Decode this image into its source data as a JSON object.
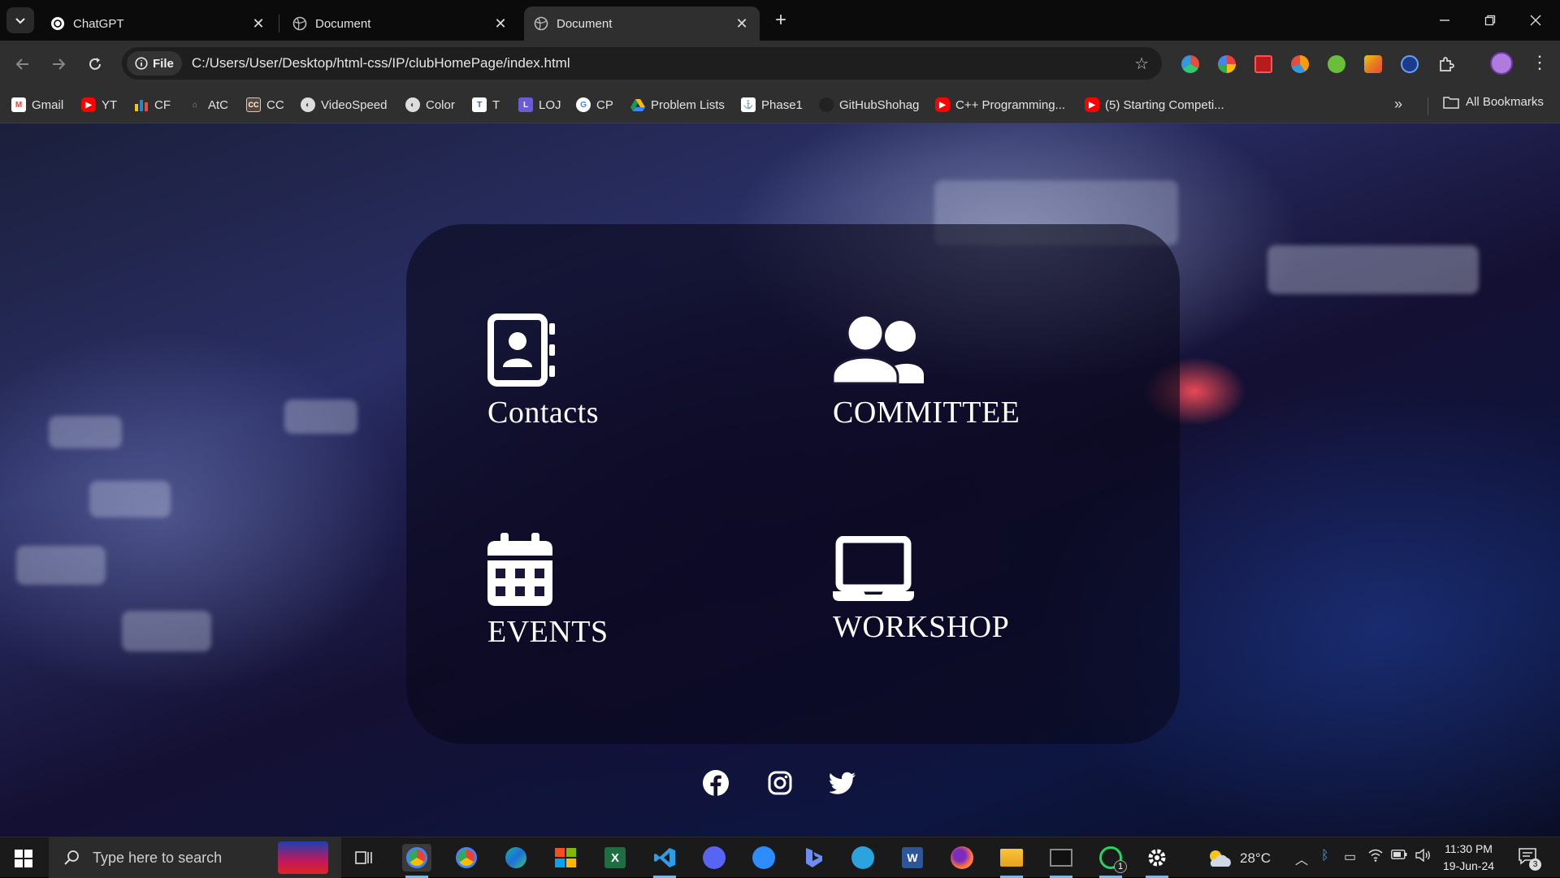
{
  "browser": {
    "tabs": [
      {
        "title": "ChatGPT",
        "active": false
      },
      {
        "title": "Document",
        "active": false
      },
      {
        "title": "Document",
        "active": true
      }
    ],
    "url_scheme_chip": "File",
    "url": "C:/Users/User/Desktop/html-css/IP/clubHomePage/index.html"
  },
  "bookmarks": [
    {
      "label": "Gmail",
      "icon": "gmail-icon",
      "color": "#ea4335"
    },
    {
      "label": "YT",
      "icon": "youtube-icon",
      "color": "#ff0000"
    },
    {
      "label": "CF",
      "icon": "codeforces-icon",
      "color": "#1f8acb"
    },
    {
      "label": "AtC",
      "icon": "atcoder-icon",
      "color": "#555555"
    },
    {
      "label": "CC",
      "icon": "codechef-icon",
      "color": "#5b4638"
    },
    {
      "label": "VideoSpeed",
      "icon": "globe-icon",
      "color": "#666666"
    },
    {
      "label": "Color",
      "icon": "globe-icon",
      "color": "#666666"
    },
    {
      "label": "T",
      "icon": "toph-icon",
      "color": "#2b6cb0"
    },
    {
      "label": "LOJ",
      "icon": "lightoj-icon",
      "color": "#6b5bd6"
    },
    {
      "label": "CP",
      "icon": "google-icon",
      "color": "#4285f4"
    },
    {
      "label": "Problem Lists",
      "icon": "drive-icon",
      "color": "#0f9d58"
    },
    {
      "label": "Phase1",
      "icon": "phase-icon",
      "color": "#444444"
    },
    {
      "label": "GitHubShohag",
      "icon": "github-icon",
      "color": "#222222"
    },
    {
      "label": "C++ Programming...",
      "icon": "youtube-icon",
      "color": "#ff0000"
    },
    {
      "label": "(5) Starting Competi...",
      "icon": "youtube-icon",
      "color": "#ff0000"
    }
  ],
  "all_bookmarks_label": "All Bookmarks",
  "page": {
    "cards": [
      {
        "label": "Contacts",
        "icon": "address-book-icon"
      },
      {
        "label": "COMMITTEE",
        "icon": "users-icon"
      },
      {
        "label": "EVENTS",
        "icon": "calendar-icon"
      },
      {
        "label": "WORKSHOP",
        "icon": "laptop-icon"
      }
    ],
    "social": [
      "facebook-icon",
      "instagram-icon",
      "twitter-icon"
    ]
  },
  "taskbar": {
    "search_placeholder": "Type here to search",
    "weather": "28°C",
    "time": "11:30 PM",
    "date": "19-Jun-24",
    "notification_count": "3",
    "whatsapp_badge": "1"
  },
  "colors": {
    "chrome_bg": "#2f2f2f",
    "tab_strip_bg": "#0b0b0b",
    "panel_bg": "rgba(10,8,28,0.62)",
    "card_text": "#ffffff"
  }
}
